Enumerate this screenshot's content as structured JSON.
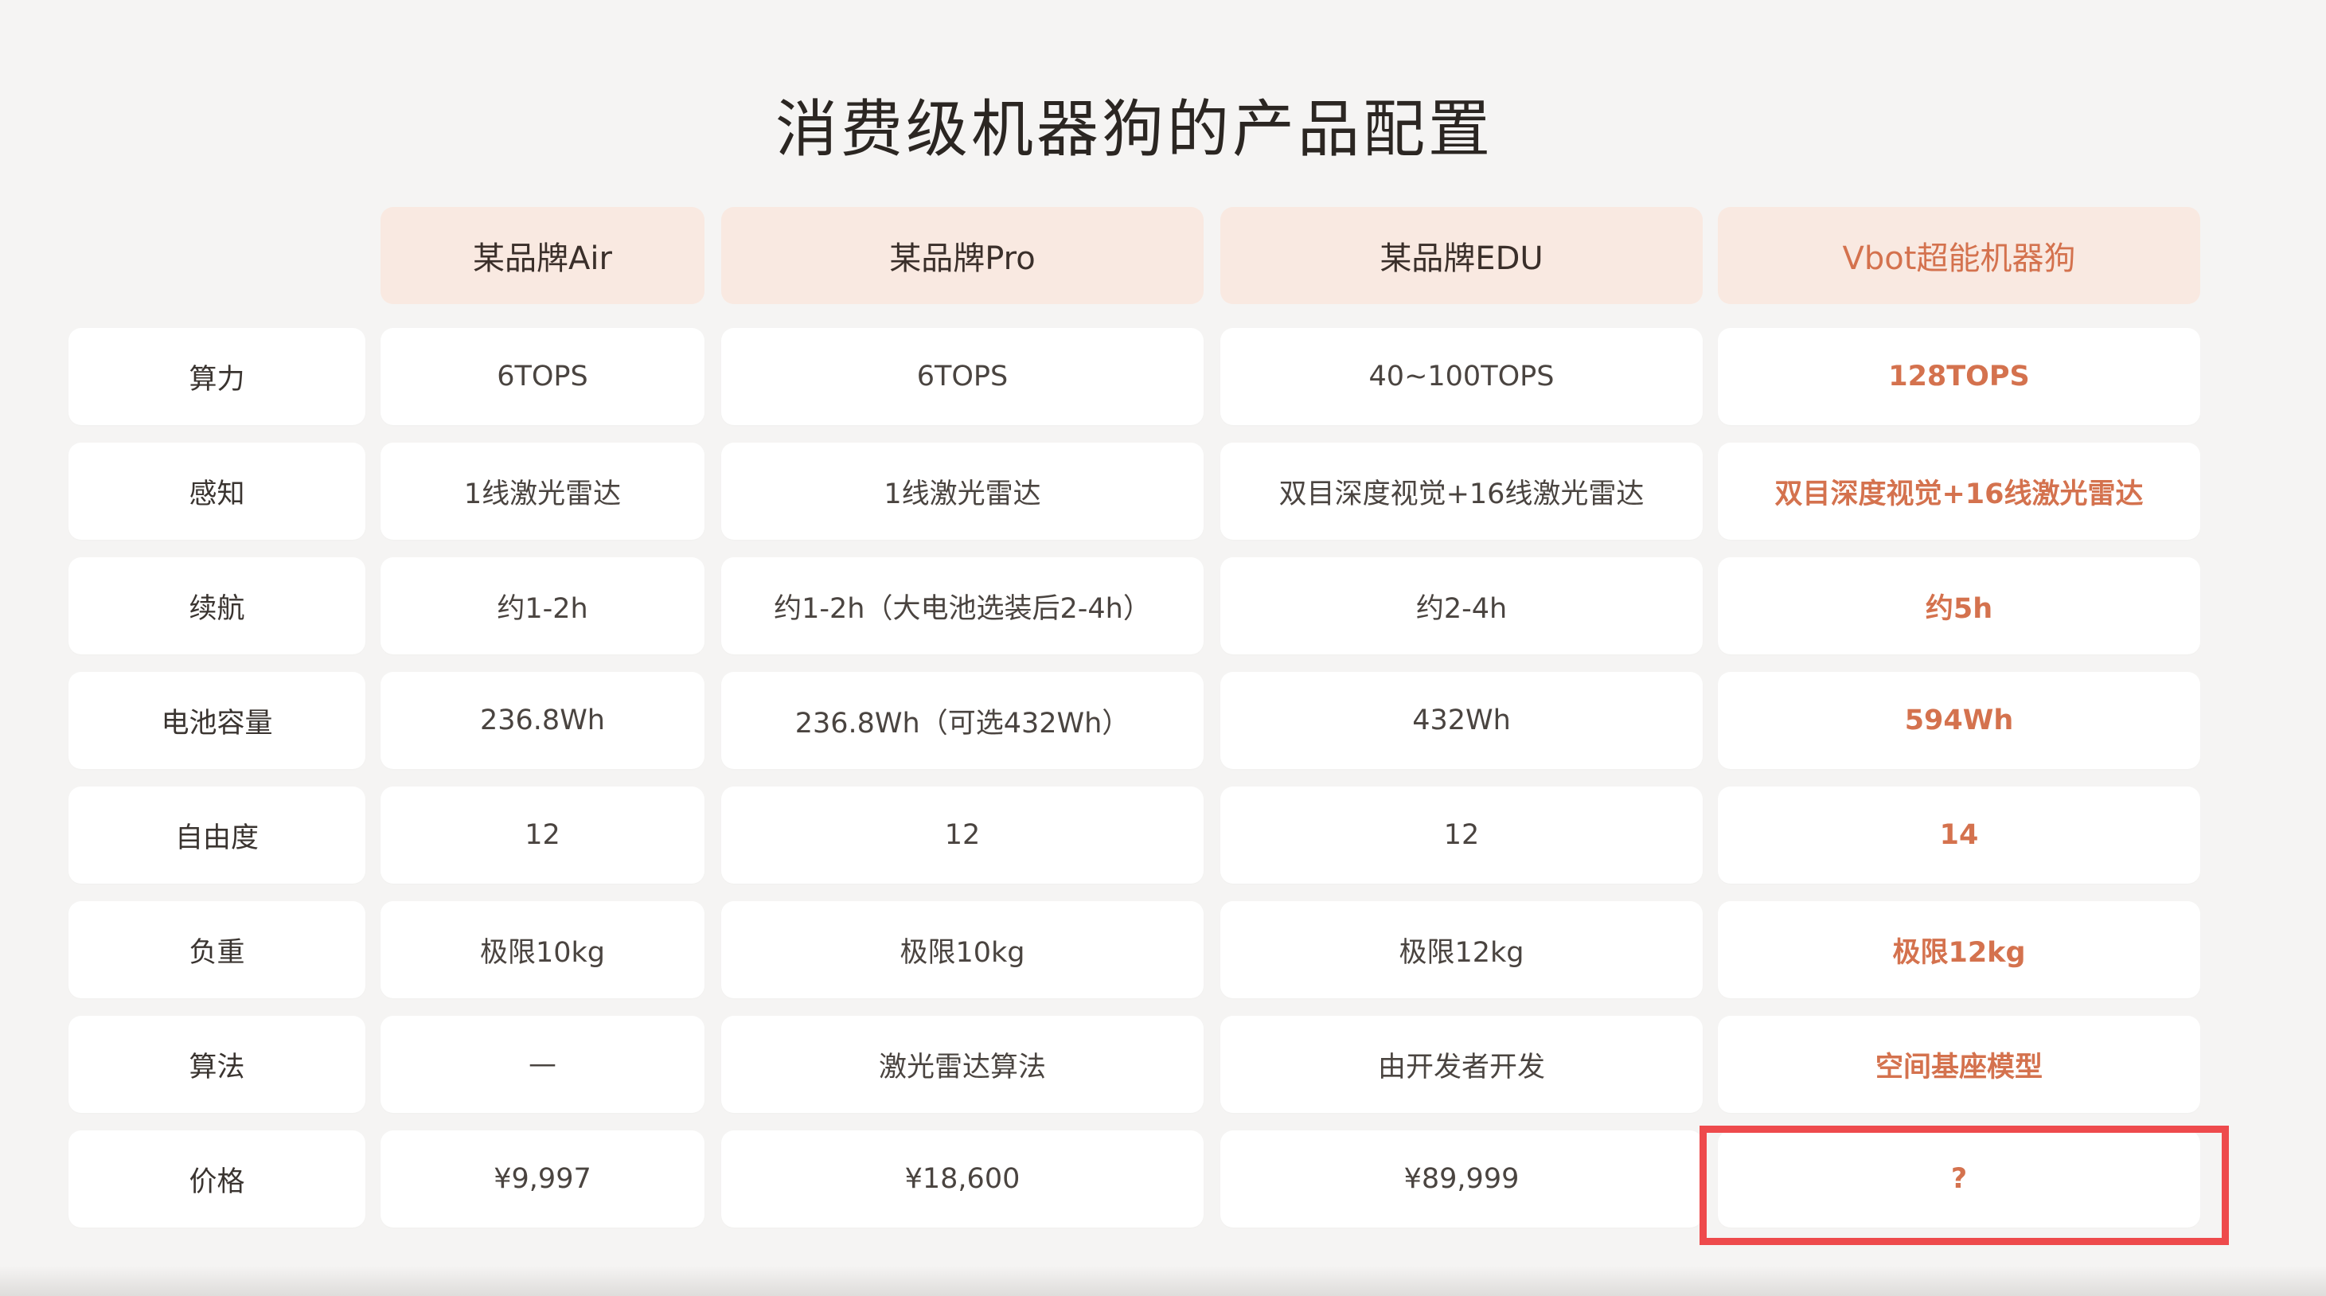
{
  "title": "消费级机器狗的产品配置",
  "columns": [
    "某品牌Air",
    "某品牌Pro",
    "某品牌EDU",
    "Vbot超能机器狗"
  ],
  "rows": [
    {
      "label": "算力",
      "values": [
        "6TOPS",
        "6TOPS",
        "40~100TOPS",
        "128TOPS"
      ]
    },
    {
      "label": "感知",
      "values": [
        "1线激光雷达",
        "1线激光雷达",
        "双目深度视觉+16线激光雷达",
        "双目深度视觉+16线激光雷达"
      ]
    },
    {
      "label": "续航",
      "values": [
        "约1-2h",
        "约1-2h（大电池选装后2-4h）",
        "约2-4h",
        "约5h"
      ]
    },
    {
      "label": "电池容量",
      "values": [
        "236.8Wh",
        "236.8Wh（可选432Wh）",
        "432Wh",
        "594Wh"
      ]
    },
    {
      "label": "自由度",
      "values": [
        "12",
        "12",
        "12",
        "14"
      ]
    },
    {
      "label": "负重",
      "values": [
        "极限10kg",
        "极限10kg",
        "极限12kg",
        "极限12kg"
      ]
    },
    {
      "label": "算法",
      "values": [
        "—",
        "激光雷达算法",
        "由开发者开发",
        "空间基座模型"
      ]
    },
    {
      "label": "价格",
      "values": [
        "¥9,997",
        "¥18,600",
        "¥89,999",
        "?"
      ]
    }
  ],
  "colors": {
    "accent": "#d4724e",
    "header_bg": "#f9e9e1",
    "cell_bg": "#ffffff",
    "page_bg": "#f5f4f3",
    "highlight_border": "#ee4a4c"
  }
}
